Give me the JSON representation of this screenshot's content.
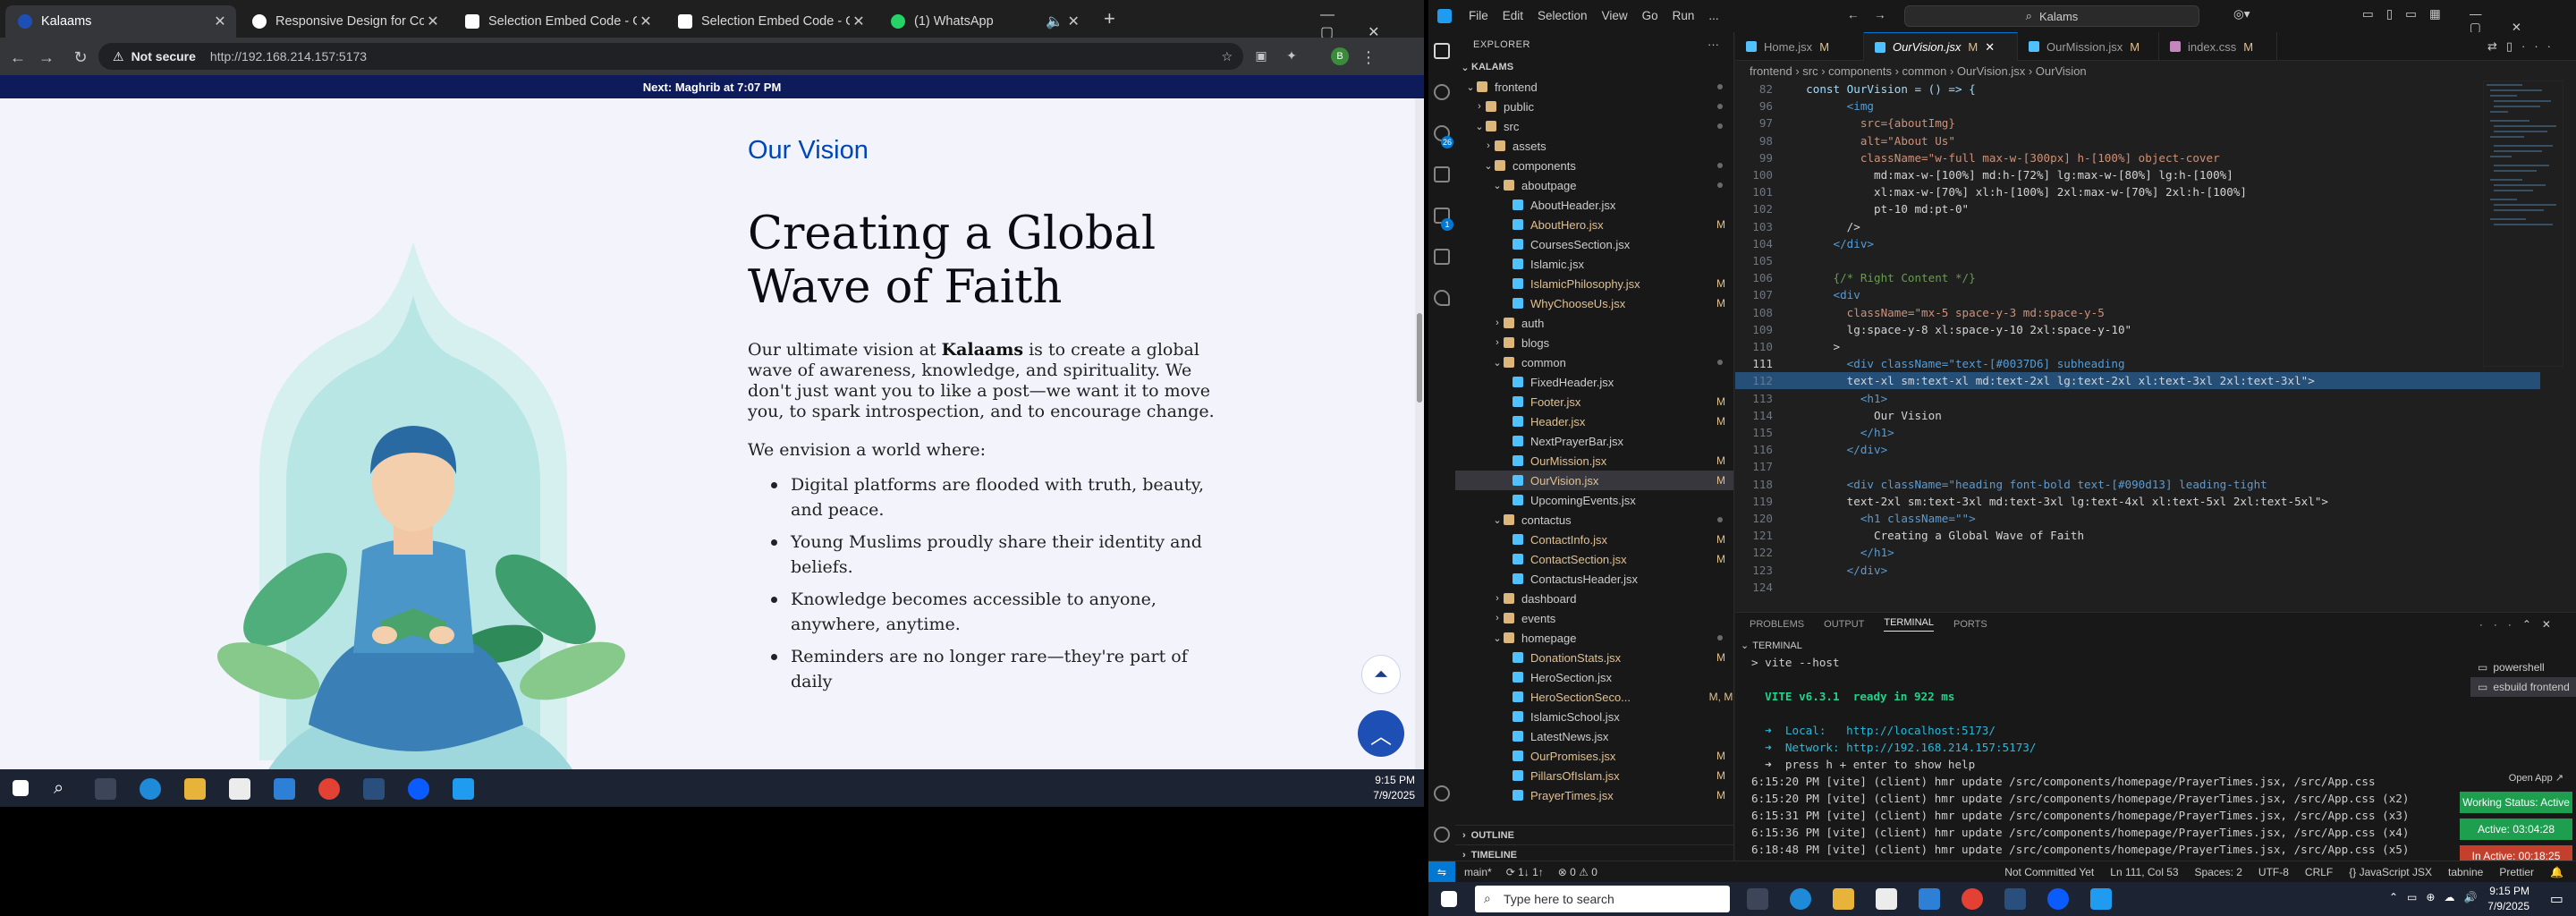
{
  "browser": {
    "tabs": [
      {
        "label": "Kalaams",
        "active": true
      },
      {
        "label": "Responsive Design for Contact"
      },
      {
        "label": "Selection Embed Code - Goog"
      },
      {
        "label": "Selection Embed Code - Goog"
      },
      {
        "label": "(1) WhatsApp"
      }
    ],
    "new_tab": "+",
    "security": "Not secure",
    "url": "http://192.168.214.157:5173",
    "prayer_bar": "Next: Maghrib at 7:07 PM"
  },
  "page": {
    "kicker": "Our Vision",
    "heading": "Creating a Global Wave of Faith",
    "para_before": "Our ultimate vision at ",
    "para_brand": "Kalaams",
    "para_after": " is to create a global wave of awareness, knowledge, and spirituality. We don't just want you to like a post—we want it to move you, to spark introspection, and to encourage change.",
    "lead": "We envision a world where:",
    "bullets": [
      "Digital platforms are flooded with truth, beauty, and peace.",
      "Young Muslims proudly share their identity and beliefs.",
      "Knowledge becomes accessible to anyone, anywhere, anytime.",
      "Reminders are no longer rare—they're part of daily"
    ]
  },
  "left_taskbar": {
    "time": "9:15 PM",
    "date": "7/9/2025"
  },
  "vscode": {
    "menu": [
      "File",
      "Edit",
      "Selection",
      "View",
      "Go",
      "Run",
      "..."
    ],
    "search": "Kalams",
    "explorer_title": "EXPLORER",
    "workspace": "KALAMS",
    "tree": [
      {
        "name": "frontend",
        "type": "folder",
        "depth": 1,
        "open": true,
        "status": "dot"
      },
      {
        "name": "public",
        "type": "folder",
        "depth": 2,
        "open": false,
        "status": "dot"
      },
      {
        "name": "src",
        "type": "folder",
        "depth": 2,
        "open": true,
        "status": "dot"
      },
      {
        "name": "assets",
        "type": "folder",
        "depth": 3,
        "open": false,
        "status": ""
      },
      {
        "name": "components",
        "type": "folder",
        "depth": 3,
        "open": true,
        "status": "dot"
      },
      {
        "name": "aboutpage",
        "type": "folder",
        "depth": 4,
        "open": true,
        "status": "dot"
      },
      {
        "name": "AboutHeader.jsx",
        "type": "jsx",
        "depth": 5,
        "status": ""
      },
      {
        "name": "AboutHero.jsx",
        "type": "jsx",
        "depth": 5,
        "status": "M"
      },
      {
        "name": "CoursesSection.jsx",
        "type": "jsx",
        "depth": 5,
        "status": ""
      },
      {
        "name": "Islamic.jsx",
        "type": "jsx",
        "depth": 5,
        "status": ""
      },
      {
        "name": "IslamicPhilosophy.jsx",
        "type": "jsx",
        "depth": 5,
        "status": "M"
      },
      {
        "name": "WhyChooseUs.jsx",
        "type": "jsx",
        "depth": 5,
        "status": "M"
      },
      {
        "name": "auth",
        "type": "folder",
        "depth": 4,
        "open": false,
        "status": ""
      },
      {
        "name": "blogs",
        "type": "folder",
        "depth": 4,
        "open": false,
        "status": ""
      },
      {
        "name": "common",
        "type": "folder",
        "depth": 4,
        "open": true,
        "status": "dot"
      },
      {
        "name": "FixedHeader.jsx",
        "type": "jsx",
        "depth": 5,
        "status": ""
      },
      {
        "name": "Footer.jsx",
        "type": "jsx",
        "depth": 5,
        "status": "M"
      },
      {
        "name": "Header.jsx",
        "type": "jsx",
        "depth": 5,
        "status": "M"
      },
      {
        "name": "NextPrayerBar.jsx",
        "type": "jsx",
        "depth": 5,
        "status": ""
      },
      {
        "name": "OurMission.jsx",
        "type": "jsx",
        "depth": 5,
        "status": "M"
      },
      {
        "name": "OurVision.jsx",
        "type": "jsx",
        "depth": 5,
        "status": "M",
        "selected": true
      },
      {
        "name": "UpcomingEvents.jsx",
        "type": "jsx",
        "depth": 5,
        "status": ""
      },
      {
        "name": "contactus",
        "type": "folder",
        "depth": 4,
        "open": true,
        "status": "dot"
      },
      {
        "name": "ContactInfo.jsx",
        "type": "jsx",
        "depth": 5,
        "status": "M"
      },
      {
        "name": "ContactSection.jsx",
        "type": "jsx",
        "depth": 5,
        "status": "M"
      },
      {
        "name": "ContactusHeader.jsx",
        "type": "jsx",
        "depth": 5,
        "status": ""
      },
      {
        "name": "dashboard",
        "type": "folder",
        "depth": 4,
        "open": false,
        "status": ""
      },
      {
        "name": "events",
        "type": "folder",
        "depth": 4,
        "open": false,
        "status": ""
      },
      {
        "name": "homepage",
        "type": "folder",
        "depth": 4,
        "open": true,
        "status": "dot"
      },
      {
        "name": "DonationStats.jsx",
        "type": "jsx",
        "depth": 5,
        "status": "M"
      },
      {
        "name": "HeroSection.jsx",
        "type": "jsx",
        "depth": 5,
        "status": ""
      },
      {
        "name": "HeroSectionSeco...",
        "type": "jsx",
        "depth": 5,
        "status": "M, M"
      },
      {
        "name": "IslamicSchool.jsx",
        "type": "jsx",
        "depth": 5,
        "status": ""
      },
      {
        "name": "LatestNews.jsx",
        "type": "jsx",
        "depth": 5,
        "status": ""
      },
      {
        "name": "OurPromises.jsx",
        "type": "jsx",
        "depth": 5,
        "status": "M"
      },
      {
        "name": "PillarsOfIslam.jsx",
        "type": "jsx",
        "depth": 5,
        "status": "M"
      },
      {
        "name": "PrayerTimes.jsx",
        "type": "jsx",
        "depth": 5,
        "status": "M"
      }
    ],
    "outline": "OUTLINE",
    "timeline": "TIMELINE",
    "editor_tabs": [
      {
        "label": "Home.jsx",
        "m": "M"
      },
      {
        "label": "OurVision.jsx",
        "m": "M",
        "active": true
      },
      {
        "label": "OurMission.jsx",
        "m": "M"
      },
      {
        "label": "index.css",
        "m": "M"
      }
    ],
    "breadcrumb": "frontend › src › components › common › OurVision.jsx › OurVision",
    "code": [
      {
        "n": "82",
        "t": "  const OurVision = () => {"
      },
      {
        "n": "96",
        "t": "        <img"
      },
      {
        "n": "97",
        "t": "          src={aboutImg}"
      },
      {
        "n": "98",
        "t": "          alt=\"About Us\""
      },
      {
        "n": "99",
        "t": "          className=\"w-full max-w-[300px] h-[100%] object-cover"
      },
      {
        "n": "100",
        "t": "            md:max-w-[100%] md:h-[72%] lg:max-w-[80%] lg:h-[100%]"
      },
      {
        "n": "101",
        "t": "            xl:max-w-[70%] xl:h-[100%] 2xl:max-w-[70%] 2xl:h-[100%]"
      },
      {
        "n": "102",
        "t": "            pt-10 md:pt-0\""
      },
      {
        "n": "103",
        "t": "        />"
      },
      {
        "n": "104",
        "t": "      </div>"
      },
      {
        "n": "105",
        "t": ""
      },
      {
        "n": "106",
        "t": "      {/* Right Content */}"
      },
      {
        "n": "107",
        "t": "      <div"
      },
      {
        "n": "108",
        "t": "        className=\"mx-5 space-y-3 md:space-y-5"
      },
      {
        "n": "109",
        "t": "        lg:space-y-8 xl:space-y-10 2xl:space-y-10\""
      },
      {
        "n": "110",
        "t": "      >"
      },
      {
        "n": "111",
        "t": "        <div className=\"text-[#0037D6] subheading"
      },
      {
        "n": "112",
        "t": "        text-xl sm:text-xl md:text-2xl lg:text-2xl xl:text-3xl 2xl:text-3xl\">"
      },
      {
        "n": "113",
        "t": "          <h1>"
      },
      {
        "n": "114",
        "t": "            Our Vision"
      },
      {
        "n": "115",
        "t": "          </h1>"
      },
      {
        "n": "116",
        "t": "        </div>"
      },
      {
        "n": "117",
        "t": ""
      },
      {
        "n": "118",
        "t": "        <div className=\"heading font-bold text-[#090d13] leading-tight"
      },
      {
        "n": "119",
        "t": "        text-2xl sm:text-3xl md:text-3xl lg:text-4xl xl:text-5xl 2xl:text-5xl\">"
      },
      {
        "n": "120",
        "t": "          <h1 className=\"\">"
      },
      {
        "n": "121",
        "t": "            Creating a Global Wave of Faith"
      },
      {
        "n": "122",
        "t": "          </h1>"
      },
      {
        "n": "123",
        "t": "        </div>"
      },
      {
        "n": "124",
        "t": ""
      }
    ],
    "panel_tabs": [
      "PROBLEMS",
      "OUTPUT",
      "TERMINAL",
      "PORTS"
    ],
    "terminal_title": "TERMINAL",
    "terminal": [
      "> vite --host",
      "",
      "  VITE v6.3.1  ready in 922 ms",
      "",
      "  ➜  Local:   http://localhost:5173/",
      "  ➜  Network: http://192.168.214.157:5173/",
      "  ➜  press h + enter to show help",
      "6:15:20 PM [vite] (client) hmr update /src/components/homepage/PrayerTimes.jsx, /src/App.css",
      "6:15:20 PM [vite] (client) hmr update /src/components/homepage/PrayerTimes.jsx, /src/App.css (x2)",
      "6:15:31 PM [vite] (client) hmr update /src/components/homepage/PrayerTimes.jsx, /src/App.css (x3)",
      "6:15:36 PM [vite] (client) hmr update /src/components/homepage/PrayerTimes.jsx, /src/App.css (x4)",
      "6:18:48 PM [vite] (client) hmr update /src/components/homepage/PrayerTimes.jsx, /src/App.css (x5)"
    ],
    "terminals": [
      "powershell",
      "esbuild  frontend"
    ],
    "open_app": "Open App ↗",
    "working_status": "Working Status: Active",
    "active_time": "Active: 03:04:28",
    "inactive_time": "In Active: 00:18:25",
    "status_left": [
      "main*",
      "⟳ 1↓ 1↑",
      "⊗ 0 ⚠ 0"
    ],
    "status_right": [
      "Not Committed Yet",
      "Ln 111, Col 53",
      "Spaces: 2",
      "UTF-8",
      "CRLF",
      "{} JavaScript JSX",
      "tabnine",
      "Prettier"
    ]
  },
  "win_taskbar": {
    "search_placeholder": "Type here to search",
    "time": "9:15 PM",
    "date": "7/9/2025"
  },
  "colors": {
    "accent": "#0046b8",
    "heading": "#090d13",
    "vscode_blue": "#0078d4",
    "active_green": "#1e9e4f",
    "inactive_red": "#c4402c"
  }
}
